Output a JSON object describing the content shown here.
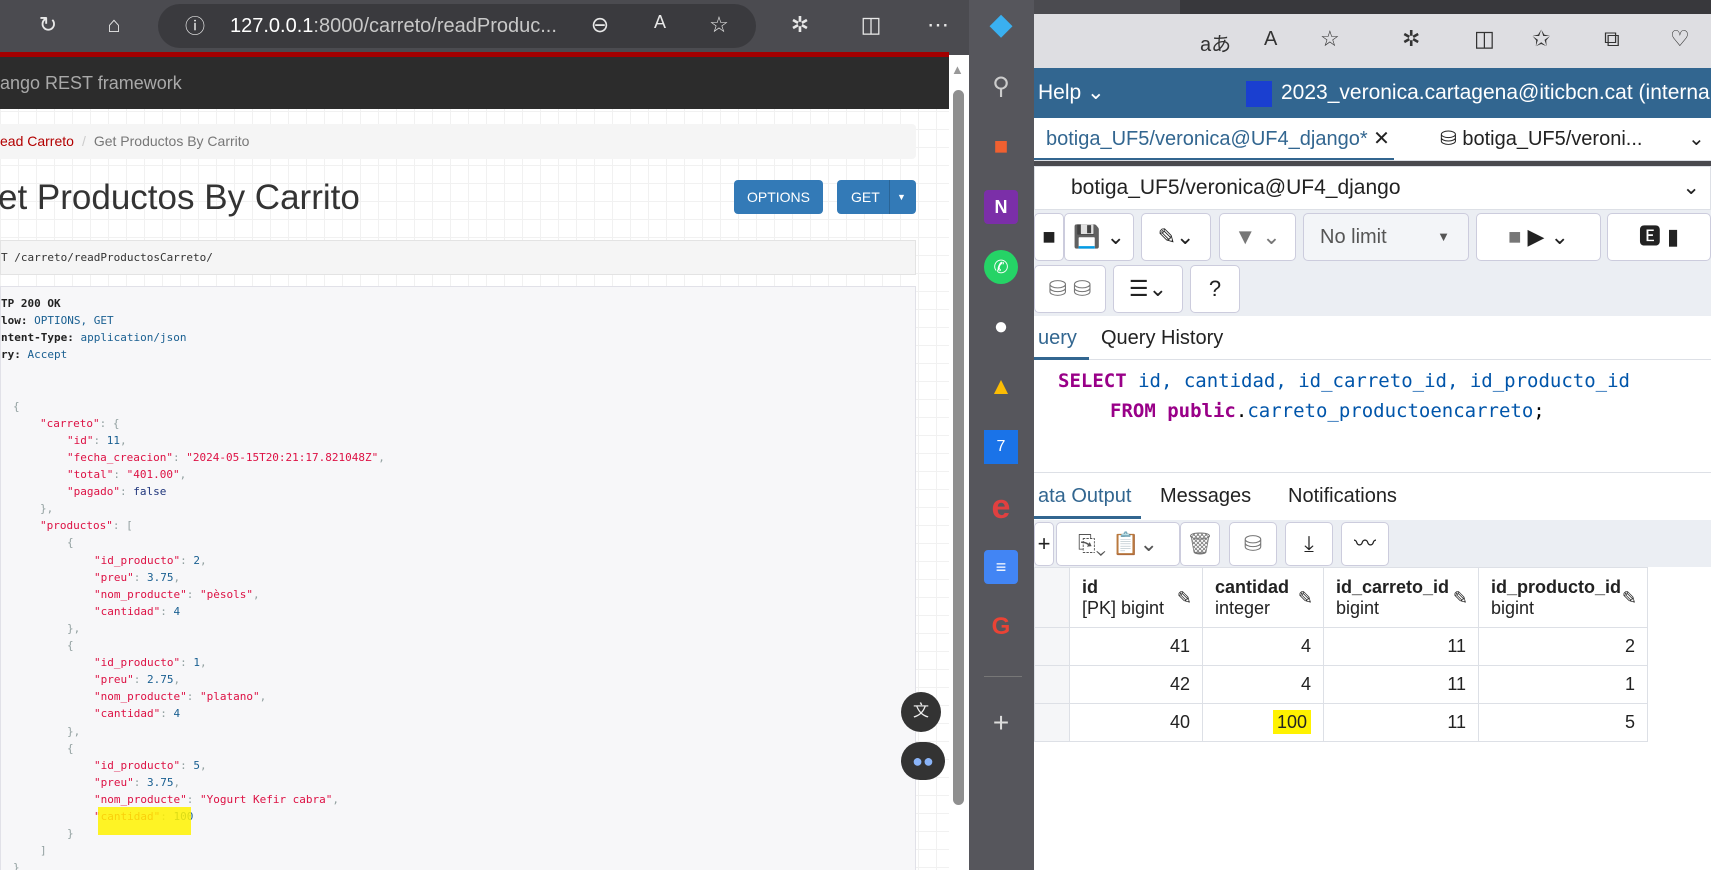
{
  "browser": {
    "url_host": "127.0.0.1",
    "url_rest": ":8000/carreto/readProduc..."
  },
  "drf": {
    "brand": "ango REST framework",
    "breadcrumb": [
      "ead Carreto",
      "Get Productos By Carrito"
    ],
    "title": "et Productos By Carrito",
    "options_label": "OPTIONS",
    "get_label": "GET",
    "request_line": "T  /carreto/readProductosCarreto/",
    "headers": [
      [
        "TP 200 OK",
        ""
      ],
      [
        "low: ",
        "OPTIONS, GET"
      ],
      [
        "ntent-Type: ",
        "application/json"
      ],
      [
        "ry: ",
        "Accept"
      ]
    ],
    "json_lines": [
      [
        0,
        [
          [
            "p",
            "{"
          ]
        ]
      ],
      [
        1,
        [
          [
            "k",
            "\"carreto\""
          ],
          [
            "p",
            ": {"
          ]
        ]
      ],
      [
        2,
        [
          [
            "k",
            "\"id\""
          ],
          [
            "p",
            ": "
          ],
          [
            "n",
            "11"
          ],
          [
            "p",
            ","
          ]
        ]
      ],
      [
        2,
        [
          [
            "k",
            "\"fecha_creacion\""
          ],
          [
            "p",
            ": "
          ],
          [
            "s",
            "\"2024-05-15T20:21:17.821048Z\""
          ],
          [
            "p",
            ","
          ]
        ]
      ],
      [
        2,
        [
          [
            "k",
            "\"total\""
          ],
          [
            "p",
            ": "
          ],
          [
            "s",
            "\"401.00\""
          ],
          [
            "p",
            ","
          ]
        ]
      ],
      [
        2,
        [
          [
            "k",
            "\"pagado\""
          ],
          [
            "p",
            ": "
          ],
          [
            "b",
            "false"
          ]
        ]
      ],
      [
        1,
        [
          [
            "p",
            "},"
          ]
        ]
      ],
      [
        1,
        [
          [
            "k",
            "\"productos\""
          ],
          [
            "p",
            ": ["
          ]
        ]
      ],
      [
        2,
        [
          [
            "p",
            "{"
          ]
        ]
      ],
      [
        3,
        [
          [
            "k",
            "\"id_producto\""
          ],
          [
            "p",
            ": "
          ],
          [
            "n",
            "2"
          ],
          [
            "p",
            ","
          ]
        ]
      ],
      [
        3,
        [
          [
            "k",
            "\"preu\""
          ],
          [
            "p",
            ": "
          ],
          [
            "n",
            "3.75"
          ],
          [
            "p",
            ","
          ]
        ]
      ],
      [
        3,
        [
          [
            "k",
            "\"nom_producte\""
          ],
          [
            "p",
            ": "
          ],
          [
            "s",
            "\"pèsols\""
          ],
          [
            "p",
            ","
          ]
        ]
      ],
      [
        3,
        [
          [
            "k",
            "\"cantidad\""
          ],
          [
            "p",
            ": "
          ],
          [
            "n",
            "4"
          ]
        ]
      ],
      [
        2,
        [
          [
            "p",
            "},"
          ]
        ]
      ],
      [
        2,
        [
          [
            "p",
            "{"
          ]
        ]
      ],
      [
        3,
        [
          [
            "k",
            "\"id_producto\""
          ],
          [
            "p",
            ": "
          ],
          [
            "n",
            "1"
          ],
          [
            "p",
            ","
          ]
        ]
      ],
      [
        3,
        [
          [
            "k",
            "\"preu\""
          ],
          [
            "p",
            ": "
          ],
          [
            "n",
            "2.75"
          ],
          [
            "p",
            ","
          ]
        ]
      ],
      [
        3,
        [
          [
            "k",
            "\"nom_producte\""
          ],
          [
            "p",
            ": "
          ],
          [
            "s",
            "\"platano\""
          ],
          [
            "p",
            ","
          ]
        ]
      ],
      [
        3,
        [
          [
            "k",
            "\"cantidad\""
          ],
          [
            "p",
            ": "
          ],
          [
            "n",
            "4"
          ]
        ]
      ],
      [
        2,
        [
          [
            "p",
            "},"
          ]
        ]
      ],
      [
        2,
        [
          [
            "p",
            "{"
          ]
        ]
      ],
      [
        3,
        [
          [
            "k",
            "\"id_producto\""
          ],
          [
            "p",
            ": "
          ],
          [
            "n",
            "5"
          ],
          [
            "p",
            ","
          ]
        ]
      ],
      [
        3,
        [
          [
            "k",
            "\"preu\""
          ],
          [
            "p",
            ": "
          ],
          [
            "n",
            "3.75"
          ],
          [
            "p",
            ","
          ]
        ]
      ],
      [
        3,
        [
          [
            "k",
            "\"nom_producte\""
          ],
          [
            "p",
            ": "
          ],
          [
            "s",
            "\"Yogurt Kefir cabra\""
          ],
          [
            "p",
            ","
          ]
        ]
      ],
      [
        3,
        [
          [
            "k",
            "\"cantidad\""
          ],
          [
            "p",
            ": "
          ],
          [
            "n",
            "100"
          ]
        ]
      ],
      [
        2,
        [
          [
            "p",
            "}"
          ]
        ]
      ],
      [
        1,
        [
          [
            "p",
            "]"
          ]
        ]
      ],
      [
        0,
        [
          [
            "p",
            "}"
          ]
        ]
      ]
    ]
  },
  "pgadmin": {
    "menu_help": "Help",
    "user": "2023_veronica.cartagena@iticbcn.cat (interna",
    "tabs": [
      "botiga_UF5/veronica@UF4_django*",
      "botiga_UF5/veroni..."
    ],
    "connection": "botiga_UF5/veronica@UF4_django",
    "limit": "No limit",
    "query_tabs": [
      "uery",
      "Query History"
    ],
    "sql_line1": [
      "SELECT",
      "id, cantidad, id_carreto_id, id_producto_id"
    ],
    "sql_line2": [
      "FROM",
      "public",
      ".",
      "carreto_productoencarreto",
      ";"
    ],
    "output_tabs": [
      "ata Output",
      "Messages",
      "Notifications"
    ],
    "columns": [
      {
        "name": "id",
        "type": "[PK] bigint"
      },
      {
        "name": "cantidad",
        "type": "integer"
      },
      {
        "name": "id_carreto_id",
        "type": "bigint"
      },
      {
        "name": "id_producto_id",
        "type": "bigint"
      }
    ],
    "rows": [
      [
        "41",
        "4",
        "11",
        "2"
      ],
      [
        "42",
        "4",
        "11",
        "1"
      ],
      [
        "40",
        "100",
        "11",
        "5"
      ]
    ]
  },
  "colors": {
    "highlight": "#fff200",
    "pg_header": "#326690",
    "drf_red": "#a30000"
  }
}
